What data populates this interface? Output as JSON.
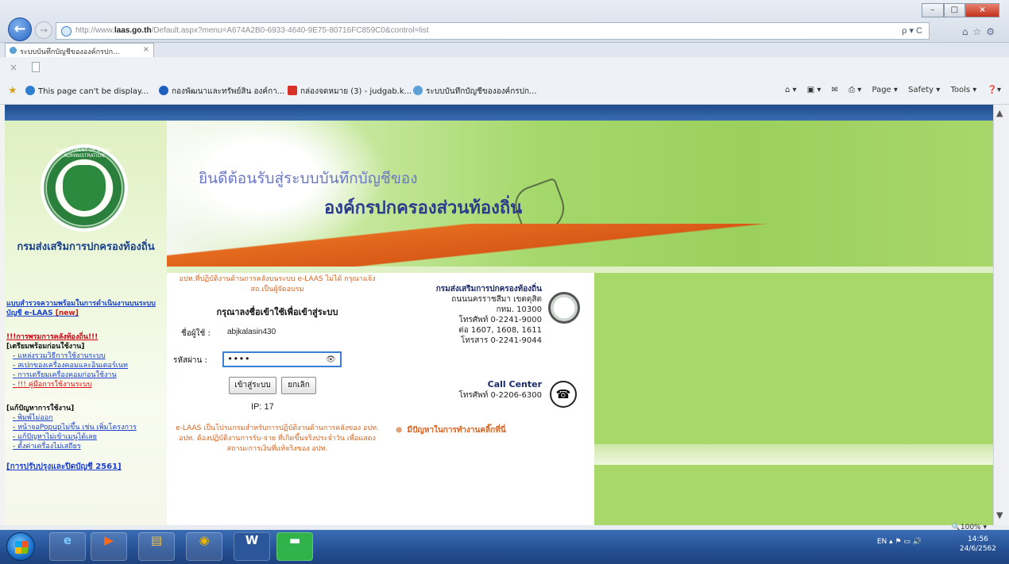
{
  "browser": {
    "url_prefix": "http://www.",
    "url_host": "laas.go.th",
    "url_rest": "/Default.aspx?menu=A674A2B0-6933-4640-9E75-80716FC859C0&control=list",
    "address_right": "ρ ▾ C",
    "tab_title": "ระบบบันทึกบัญชีขององค์กรปก...",
    "blank_tab_close": "×",
    "favorites": [
      "This page can't be display...",
      "กองพัฒนาและทรัพย์สิน องค์กา...",
      "กล่องจดหมาย (3) - judgab.k...",
      "ระบบบันทึกบัญชีขององค์กรปก..."
    ],
    "command_bar": [
      "Page ▾",
      "Safety ▾",
      "Tools ▾"
    ]
  },
  "sidebar": {
    "seal_text": "DEPARTMENT OF LOCAL ADMINISTRATION",
    "org_name": "กรมส่งเสริมการปกครองท้องถิ่น",
    "survey_text": "แบบสำรวจความพร้อมในการดำเนินงานบนระบบบัญชี e-LAAS",
    "survey_new": "[new]",
    "training_heading": "!!!การพรมการคลังท้องถิ่น!!!",
    "prepare_heading": "[เตรียมพร้อมก่อนใช้งาน]",
    "prepare_items": [
      "แหล่งรวมวิธีการใช้งานระบบ",
      "สเปกของเครื่องคอมและอินเตอร์เนท",
      "การเตรียมเครื่องคอมก่อนใช้งาน",
      "!!! คู่มือการใช้งานระบบ"
    ],
    "trouble_heading": "[แก้ปัญหาการใช้งาน]",
    "trouble_items": [
      "พิมพ์ไม่ออก",
      "หน้าจอPopupไม่ขึ้น เช่น เพิ่มโครงการ",
      "แก้ปัญหาไม่เข้าเมนูได้เลย",
      "ตั้งค่าเครื่องไม่เสถียร"
    ],
    "bottom_link": "[การปรับปรุงและปิดบัญชี 2561]"
  },
  "banner": {
    "line1": "ยินดีต้อนรับสู่ระบบบันทึกบัญชีของ",
    "line2": "องค์กรปกครองส่วนท้องถิ่น"
  },
  "login": {
    "notice_top": "อปท.ที่ปฏิบัติงานด้านการคลังบนระบบ e-LAAS ไม่ได้ กรุณาแจ้ง สถ.เป็นผู้จัดอบรม",
    "heading": "กรุณาลงชื่อเข้าใช้เพื่อเข้าสู่ระบบ",
    "username_label": "ชื่อผู้ใช้ :",
    "username_value": "abjkalasin430",
    "password_label": "รหัสผ่าน :",
    "password_value": "••••",
    "login_button": "เข้าสู่ระบบ",
    "cancel_button": "ยกเลิก",
    "ip_text": "IP: 17",
    "notice_bottom": "e-LAAS เป็นโปรแกรมสำหรับการปฏิบัติงานด้านการคลังของ อปท. อปท. ต้องปฏิบัติงานการรับ-จ่าย ที่เกิดขึ้นจริงประจำวัน เพื่อแสดงสถานะการเงินที่แท้จริงของ อปท."
  },
  "contact": {
    "org": "กรมส่งเสริมการปกครองท้องถิ่น",
    "road": "ถนนนครราชสีมา เขตดุสิต",
    "city": "กทม. 10300",
    "phone": "โทรศัพท์ 0-2241-9000",
    "ext": "ต่อ 1607, 1608, 1611",
    "fax": "โทรสาร 0-2241-9044",
    "callcenter_title": "Call Center",
    "callcenter_phone": "โทรศัพท์ 0-2206-6300",
    "problem_link": "มีปัญหาในการทำงานคลิ๊กที่นี่"
  },
  "status": {
    "zoom": "🔍100% ▾",
    "lang": "EN",
    "time": "14:56",
    "date": "24/6/2562"
  }
}
